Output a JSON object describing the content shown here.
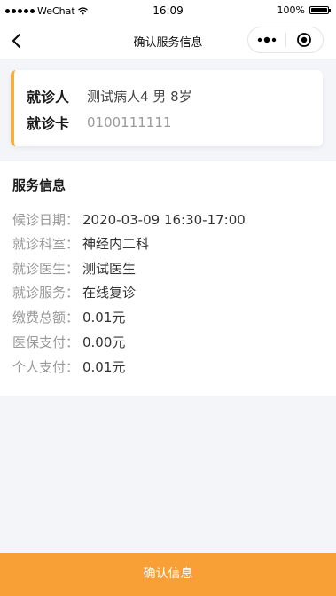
{
  "status_bar": {
    "carrier": "WeChat",
    "time": "16:09",
    "battery_percent": "100%",
    "battery_level": 1.0
  },
  "nav": {
    "title": "确认服务信息",
    "back_icon": "chevron-left-icon",
    "more_icon": "more-dots-icon",
    "close_icon": "target-circle-icon"
  },
  "patient": {
    "name_label": "就诊人",
    "name_value": "测试病人4 男 8岁",
    "card_label": "就诊卡",
    "card_value": "0100111111",
    "accent_color": "#f5b042"
  },
  "service": {
    "title": "服务信息",
    "rows": [
      {
        "label": "候诊日期：",
        "value": "2020-03-09 16:30-17:00"
      },
      {
        "label": "就诊科室：",
        "value": "神经内二科"
      },
      {
        "label": "就诊医生：",
        "value": "测试医生"
      },
      {
        "label": "就诊服务：",
        "value": "在线复诊"
      },
      {
        "label": "缴费总额：",
        "value": "0.01元"
      },
      {
        "label": "医保支付：",
        "value": "0.00元"
      },
      {
        "label": "个人支付：",
        "value": "0.01元"
      }
    ]
  },
  "confirm": {
    "label": "确认信息",
    "color": "#f8a035"
  }
}
